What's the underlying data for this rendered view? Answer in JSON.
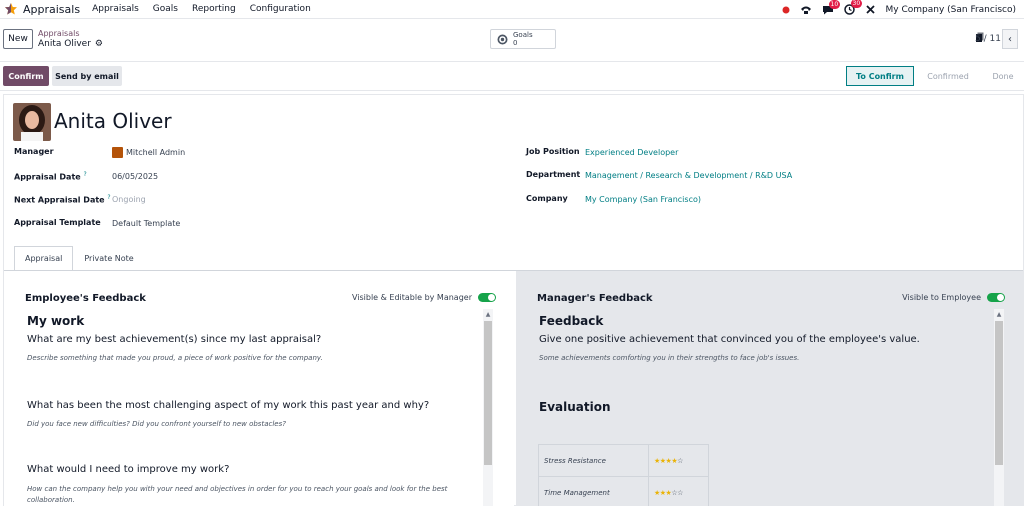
{
  "topnav": {
    "app_title": "Appraisals",
    "menu": [
      "Appraisals",
      "Goals",
      "Reporting",
      "Configuration"
    ],
    "messages_badge": "10",
    "activities_badge": "30",
    "company": "My Company (San Francisco)"
  },
  "control": {
    "new_label": "New",
    "breadcrumb_parent": "Appraisals",
    "breadcrumb_current": "Anita Oliver",
    "goals_label": "Goals",
    "goals_count": "0",
    "pager": "5 / 11"
  },
  "statusbar": {
    "confirm_label": "Confirm",
    "send_label": "Send by email",
    "stages": [
      "To Confirm",
      "Confirmed",
      "Done"
    ]
  },
  "form": {
    "employee_name": "Anita Oliver",
    "manager_label": "Manager",
    "manager_value": "Mitchell Admin",
    "appraisal_date_label": "Appraisal Date",
    "appraisal_date_help": "?",
    "appraisal_date_value": "06/05/2025",
    "next_date_label": "Next Appraisal Date",
    "next_date_help": "?",
    "next_date_value": "Ongoing",
    "template_label": "Appraisal Template",
    "template_value": "Default Template",
    "job_label": "Job Position",
    "job_value": "Experienced Developer",
    "dept_label": "Department",
    "dept_value": "Management / Research & Development / R&D USA",
    "company_label": "Company",
    "company_value": "My Company (San Francisco)"
  },
  "tabs": [
    "Appraisal",
    "Private Note"
  ],
  "employee_feedback": {
    "title": "Employee's Feedback",
    "visibility": "Visible & Editable by Manager",
    "section": "My work",
    "q1": "What are my best achievement(s) since my last appraisal?",
    "h1": "Describe something that made you proud, a piece of work positive for the company.",
    "q2": "What has been the most challenging aspect of my work this past year and why?",
    "h2": "Did you face new difficulties? Did you confront yourself to new obstacles?",
    "q3": "What would I need to improve my work?",
    "h3": "How can the company help you with your need and objectives in order for you to reach your goals and look for the best collaboration."
  },
  "manager_feedback": {
    "title": "Manager's Feedback",
    "visibility": "Visible to Employee",
    "section": "Feedback",
    "q1": "Give one positive achievement that convinced you of the employee's value.",
    "h1": "Some achievements comforting you in their strengths to face job's issues.",
    "eval_title": "Evaluation",
    "rows": [
      {
        "name": "Stress Resistance",
        "stars": 4
      },
      {
        "name": "Time Management",
        "stars": 3
      }
    ]
  },
  "colors": {
    "brand": "#714B67",
    "link": "#017e84",
    "toggle_on": "#16a34a"
  }
}
